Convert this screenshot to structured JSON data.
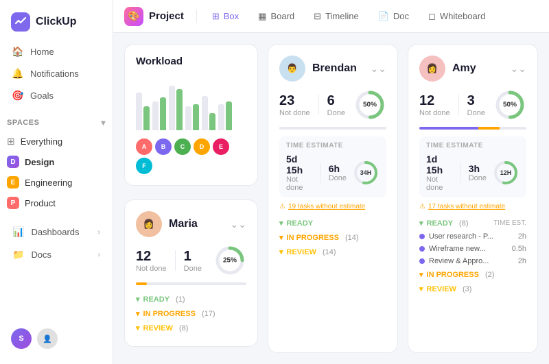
{
  "logo": {
    "text": "ClickUp"
  },
  "sidebar": {
    "nav_items": [
      {
        "id": "home",
        "label": "Home",
        "icon": "🏠"
      },
      {
        "id": "notifications",
        "label": "Notifications",
        "icon": "🔔"
      },
      {
        "id": "goals",
        "label": "Goals",
        "icon": "🎯"
      }
    ],
    "spaces_section": "Spaces",
    "spaces": [
      {
        "id": "everything",
        "label": "Everything",
        "dot": null
      },
      {
        "id": "design",
        "label": "Design",
        "dot": "design",
        "letter": "D"
      },
      {
        "id": "engineering",
        "label": "Engineering",
        "dot": "eng",
        "letter": "E"
      },
      {
        "id": "product",
        "label": "Product",
        "dot": "product",
        "letter": "P"
      }
    ],
    "bottom_items": [
      {
        "id": "dashboards",
        "label": "Dashboards"
      },
      {
        "id": "docs",
        "label": "Docs"
      }
    ]
  },
  "topnav": {
    "project_label": "Project",
    "tabs": [
      {
        "id": "box",
        "label": "Box",
        "icon": "⊞",
        "active": true
      },
      {
        "id": "board",
        "label": "Board",
        "icon": "▦"
      },
      {
        "id": "timeline",
        "label": "Timeline",
        "icon": "⊟"
      },
      {
        "id": "doc",
        "label": "Doc",
        "icon": "📄"
      },
      {
        "id": "whiteboard",
        "label": "Whiteboard",
        "icon": "◻"
      }
    ]
  },
  "workload": {
    "title": "Workload",
    "bars": [
      {
        "gray": 65,
        "green": 40
      },
      {
        "gray": 50,
        "green": 55
      },
      {
        "gray": 75,
        "green": 70
      },
      {
        "gray": 40,
        "green": 45
      },
      {
        "gray": 60,
        "green": 30
      },
      {
        "gray": 45,
        "green": 50
      }
    ]
  },
  "maria": {
    "name": "Maria",
    "not_done": 12,
    "not_done_label": "Not done",
    "done": 1,
    "done_label": "Done",
    "percent": 25,
    "percent_label": "25%",
    "progress_done_color": "#ffa500",
    "sections": [
      {
        "id": "ready",
        "label": "READY",
        "count": 1,
        "color": "ready"
      },
      {
        "id": "in_progress",
        "label": "IN PROGRESS",
        "count": 17,
        "color": "in-progress"
      },
      {
        "id": "review",
        "label": "REVIEW",
        "count": 8,
        "color": "review"
      }
    ]
  },
  "brendan": {
    "name": "Brendan",
    "not_done": 23,
    "not_done_label": "Not done",
    "done": 6,
    "done_label": "Done",
    "percent": 50,
    "percent_label": "50%",
    "time_estimate_label": "TIME ESTIMATE",
    "time_not_done": "5d 15h",
    "time_not_done_label": "Not done",
    "time_done": "6h",
    "time_done_label": "Done",
    "time_ring_label": "34H",
    "warning_text": "19 tasks without estimate",
    "sections": [
      {
        "id": "ready",
        "label": "READY",
        "count": null,
        "color": "ready"
      },
      {
        "id": "in_progress",
        "label": "IN PROGRESS",
        "count": 14,
        "color": "in-progress"
      },
      {
        "id": "review",
        "label": "REVIEW",
        "count": 14,
        "color": "review"
      }
    ]
  },
  "amy": {
    "name": "Amy",
    "not_done": 12,
    "not_done_label": "Not done",
    "done": 3,
    "done_label": "Done",
    "percent": 50,
    "percent_label": "50%",
    "time_estimate_label": "TIME ESTIMATE",
    "time_not_done": "1d 15h",
    "time_not_done_label": "Not done",
    "time_done": "3h",
    "time_done_label": "Done",
    "time_ring_label": "12H",
    "warning_text": "17 tasks without estimate",
    "ready_label": "READY",
    "ready_count": 8,
    "time_est_label": "TIME EST.",
    "tasks": [
      {
        "name": "User research - P...",
        "time": "2h"
      },
      {
        "name": "Wireframe new...",
        "time": "0.5h"
      },
      {
        "name": "Review & Appro...",
        "time": "2h"
      }
    ],
    "sections": [
      {
        "id": "in_progress",
        "label": "IN PROGRESS",
        "count": 2,
        "color": "in-progress"
      },
      {
        "id": "review",
        "label": "REVIEW",
        "count": 3,
        "color": "review"
      }
    ]
  }
}
